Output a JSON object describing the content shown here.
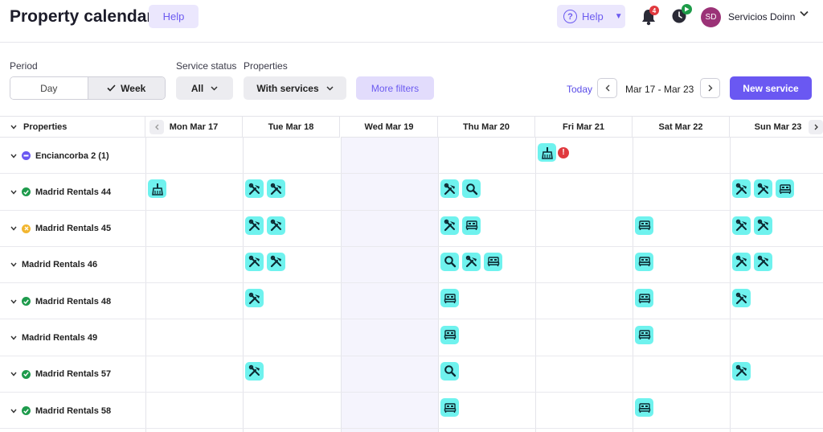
{
  "header": {
    "title": "Property calendar",
    "help_button": "Help",
    "help_menu": "Help",
    "notifications_count": "4",
    "user_initials": "SD",
    "user_name": "Servicios Doinn"
  },
  "filters": {
    "period_label": "Period",
    "period_options": [
      "Day",
      "Week"
    ],
    "period_selected": "Week",
    "service_status_label": "Service status",
    "service_status_value": "All",
    "properties_label": "Properties",
    "properties_value": "With services",
    "more_filters": "More filters",
    "today": "Today",
    "date_range": "Mar 17 - Mar 23",
    "new_service": "New service"
  },
  "calendar": {
    "properties_header": "Properties",
    "days": [
      "Mon Mar 17",
      "Tue Mar 18",
      "Wed Mar 19",
      "Thu Mar 20",
      "Fri Mar 21",
      "Sat Mar 22",
      "Sun Mar 23"
    ],
    "rows": [
      {
        "name": "Enciancorba 2 (1)",
        "status": "partial",
        "cells": [
          [],
          [],
          [],
          [],
          [
            "cleaning",
            "alert"
          ],
          [],
          []
        ]
      },
      {
        "name": "Madrid Rentals 44",
        "status": "ok",
        "cells": [
          [
            "cleaning"
          ],
          [
            "tools",
            "tools"
          ],
          [],
          [
            "tools",
            "search"
          ],
          [],
          [],
          [
            "tools",
            "tools",
            "bed"
          ]
        ]
      },
      {
        "name": "Madrid Rentals 45",
        "status": "warning",
        "cells": [
          [],
          [
            "tools",
            "tools"
          ],
          [],
          [
            "tools",
            "bed"
          ],
          [],
          [
            "bed"
          ],
          [
            "tools",
            "tools"
          ]
        ]
      },
      {
        "name": "Madrid Rentals 46",
        "status": "none",
        "cells": [
          [],
          [
            "tools",
            "tools"
          ],
          [],
          [
            "search",
            "tools",
            "bed"
          ],
          [],
          [
            "bed"
          ],
          [
            "tools",
            "tools"
          ]
        ]
      },
      {
        "name": "Madrid Rentals 48",
        "status": "ok",
        "cells": [
          [],
          [
            "tools"
          ],
          [],
          [
            "bed"
          ],
          [],
          [
            "bed"
          ],
          [
            "tools"
          ]
        ]
      },
      {
        "name": "Madrid Rentals 49",
        "status": "none",
        "cells": [
          [],
          [],
          [],
          [
            "bed"
          ],
          [],
          [
            "bed"
          ],
          []
        ]
      },
      {
        "name": "Madrid Rentals 57",
        "status": "ok",
        "cells": [
          [],
          [
            "tools"
          ],
          [],
          [
            "search"
          ],
          [],
          [],
          [
            "tools"
          ]
        ]
      },
      {
        "name": "Madrid Rentals 58",
        "status": "ok",
        "cells": [
          [],
          [],
          [],
          [
            "bed"
          ],
          [],
          [
            "bed"
          ],
          []
        ]
      }
    ]
  },
  "colors": {
    "accent": "#6a58f2",
    "service_tile": "#6ff2ee",
    "status_ok": "#1e9b4c",
    "status_warning": "#f2b630",
    "status_partial": "#6a58f2",
    "alert": "#e0393e"
  }
}
